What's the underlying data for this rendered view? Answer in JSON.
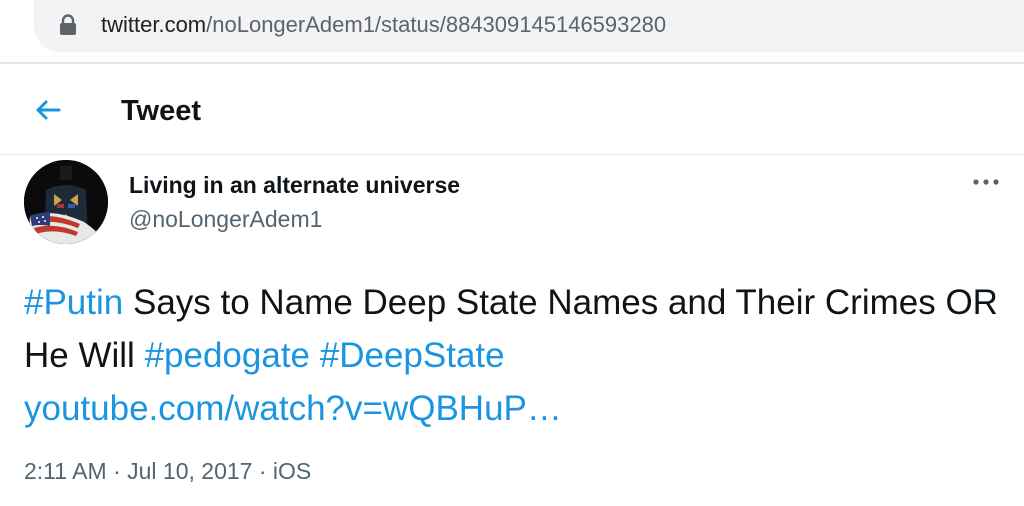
{
  "browser": {
    "url_host": "twitter.com",
    "url_path": "/noLongerAdem1/status/884309145146593280",
    "lock_icon": "lock-icon"
  },
  "header": {
    "back_icon": "arrow-left-icon",
    "title": "Tweet"
  },
  "tweet": {
    "author": {
      "display_name": "Living in an alternate universe",
      "username": "@noLongerAdem1",
      "avatar_icon": "avatar-uniformed-figure"
    },
    "more_icon": "more-horizontal-icon",
    "segments": {
      "hashtag_putin": "#Putin",
      "text_1": " Says to Name Deep State Names and Their Crimes OR He Will ",
      "hashtag_pedogate": "#pedogate",
      "hashtag_deepstate": "#DeepState",
      "link": "youtube.com/watch?v=wQBHuP…"
    },
    "time": "2:11 AM",
    "separator": " · ",
    "date": "Jul 10, 2017",
    "source": "iOS"
  },
  "colors": {
    "link": "#1b95e0",
    "text": "#0f1419",
    "secondary": "#536471",
    "address_bar_bg": "#f1f3f4"
  }
}
